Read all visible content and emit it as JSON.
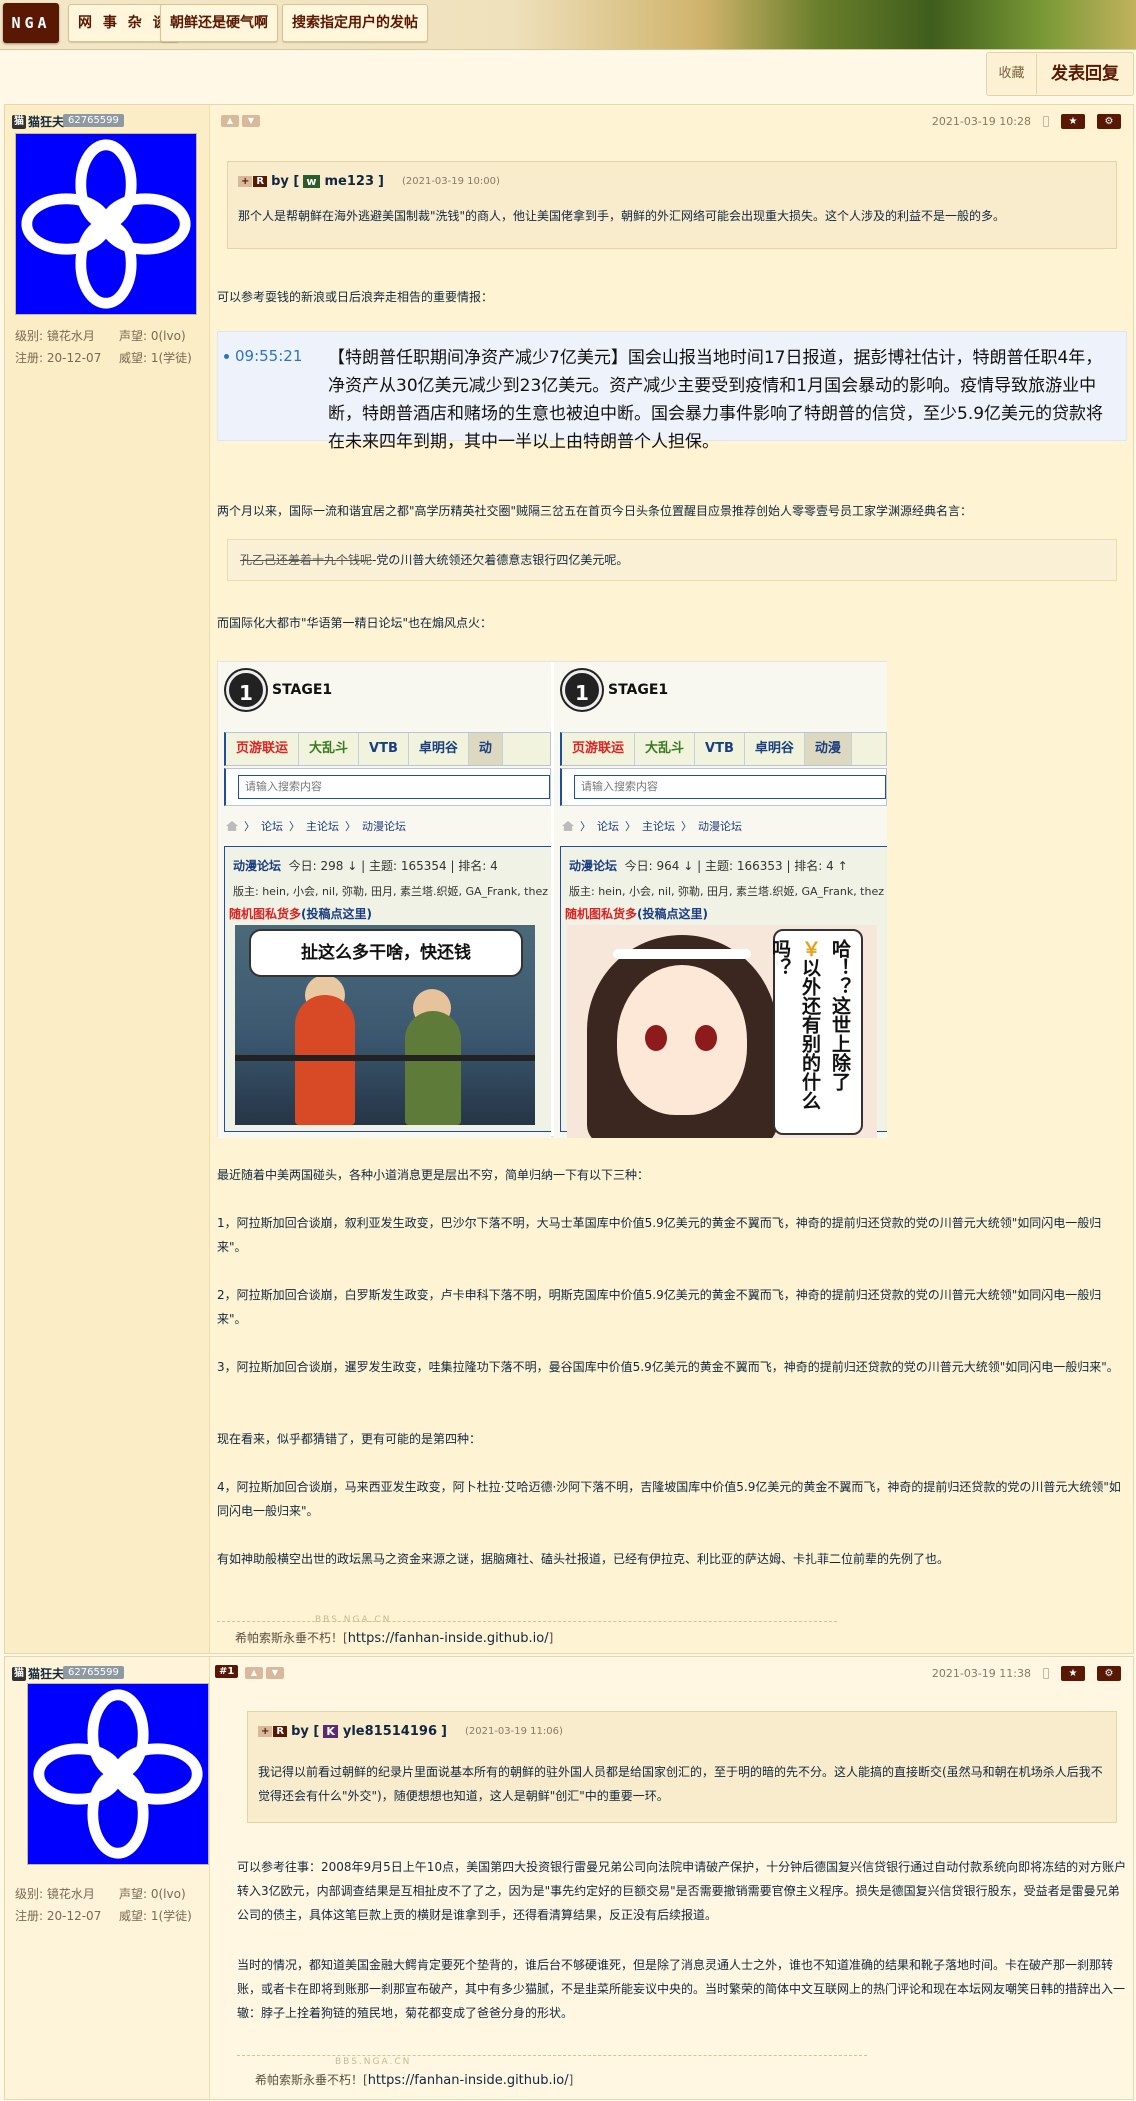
{
  "topbar": {
    "logo": "NGA",
    "crumbs": [
      "网 事 杂 谈",
      "朝鲜还是硬气啊",
      "搜索指定用户的发帖"
    ]
  },
  "actions": {
    "favorite": "收藏",
    "reply": "发表回复"
  },
  "posts": [
    {
      "author": "猫狂夫",
      "author_badge": "猫",
      "uid": "62765599",
      "level_label": "级别: 镜花水月",
      "rep_label": "声望: 0(lvo)",
      "reg_label": "注册: 20-12-07",
      "prestige_label": "威望: 1(学徒)",
      "date": "2021-03-19 10:28",
      "quote": {
        "user_badge": "w",
        "user": "me123",
        "by": "by [",
        "close": "]",
        "date": "(2021-03-19 10:00)",
        "text": "那个人是帮朝鲜在海外逃避美国制裁\"洗钱\"的商人，他让美国佬拿到手，朝鲜的外汇网络可能会出现重大损失。这个人涉及的利益不是一般的多。"
      },
      "p1": "可以参考耍钱的新浪或日后浪奔走相告的重要情报：",
      "news_time": "09:55:21",
      "news_text": "【特朗普任职期间净资产减少7亿美元】国会山报当地时间17日报道，据彭博社估计，特朗普任职4年，净资产从30亿美元减少到23亿美元。资产减少主要受到疫情和1月国会暴动的影响。疫情导致旅游业中断，特朗普酒店和赌场的生意也被迫中断。国会暴力事件影响了特朗普的信贷，至少5.9亿美元的贷款将在未来四年到期，其中一半以上由特朗普个人担保。",
      "p2": "两个月以来，国际一流和谐宜居之都\"高学历精英社交圈\"贼隔三岔五在首页今日头条位置醒目应景推荐创始人零零壹号员工家学渊源经典名言：",
      "strike_text": "孔乙己还差着十九个钱呢",
      "strike_after": "-党の川普大统领还欠着德意志银行四亿美元呢。",
      "p3": "而国际化大都市\"华语第一精日论坛\"也在煽风点火：",
      "meme": {
        "stage": "STAGE1",
        "disc": "1",
        "nav_left": [
          "页游联运",
          "大乱斗",
          "VTB",
          "卓明谷",
          "动"
        ],
        "nav_right": [
          "页游联运",
          "大乱斗",
          "VTB",
          "卓明谷",
          "动漫"
        ],
        "search_placeholder": "请输入搜索内容",
        "breadcrumb": [
          "论坛",
          "主论坛",
          "动漫论坛"
        ],
        "forum_name": "动漫论坛",
        "left_stats": "今日: 298 ↓ | 主题: 165354 | 排名: 4",
        "right_stats": "今日: 964 ↓ | 主题: 166353 | 排名: 4 ↑",
        "mods": "版主: hein, 小会, nil, 弥勒, 田月, 素兰塔.织姬, GA_Frank, thez",
        "banner_red": "随机图私货多",
        "banner_blue": "(投稿点这里)",
        "left_bubble": "扯这么多干啥，快还钱",
        "right_sign_1": "哈！？这世上除了",
        "right_sign_yen": "￥",
        "right_sign_2": "以外还有别的什么吗？"
      },
      "p4": "最近随着中美两国碰头，各种小道消息更是层出不穷，简单归纳一下有以下三种：",
      "p5": "1，阿拉斯加回合谈崩，叙利亚发生政变，巴沙尔下落不明，大马士革国库中价值5.9亿美元的黄金不翼而飞，神奇的提前归还贷款的党の川普元大统领\"如同闪电一般归来\"。",
      "p6": "2，阿拉斯加回合谈崩，白罗斯发生政变，卢卡申科下落不明，明斯克国库中价值5.9亿美元的黄金不翼而飞，神奇的提前归还贷款的党の川普元大统领\"如同闪电一般归来\"。",
      "p7": "3，阿拉斯加回合谈崩，暹罗发生政变，哇集拉隆功下落不明，曼谷国库中价值5.9亿美元的黄金不翼而飞，神奇的提前归还贷款的党の川普元大统领\"如同闪电一般归来\"。",
      "p8": "现在看来，似乎都猜错了，更有可能的是第四种：",
      "p9": "4，阿拉斯加回合谈崩，马来西亚发生政变，阿卜杜拉·艾哈迈德·沙阿下落不明，吉隆坡国库中价值5.9亿美元的黄金不翼而飞，神奇的提前归还贷款的党の川普元大统领\"如同闪电一般归来\"。",
      "p10": "有如神助般横空出世的政坛黑马之资金来源之谜，据脑瘫社、磕头社报道，已经有伊拉克、利比亚的萨达姆、卡扎菲二位前辈的先例了也。",
      "sig_tag": "BBS.NGA.CN",
      "sig_text": "希帕索斯永垂不朽！[",
      "sig_link": "https://fanhan-inside.github.io/",
      "sig_close": "]"
    },
    {
      "author": "猫狂夫",
      "author_badge": "猫",
      "uid": "62765599",
      "floor": "#1",
      "level_label": "级别: 镜花水月",
      "rep_label": "声望: 0(lvo)",
      "reg_label": "注册: 20-12-07",
      "prestige_label": "威望: 1(学徒)",
      "date": "2021-03-19 11:38",
      "quote": {
        "user_badge": "K",
        "user": "yle81514196",
        "by": "by [",
        "close": "]",
        "date": "(2021-03-19 11:06)",
        "text": "我记得以前看过朝鲜的纪录片里面说基本所有的朝鲜的驻外国人员都是给国家创汇的，至于明的暗的先不分。这人能搞的直接断交(虽然马和朝在机场杀人后我不觉得还会有什么\"外交\")，随便想想也知道，这人是朝鲜\"创汇\"中的重要一环。"
      },
      "p1": "可以参考往事：2008年9月5日上午10点，美国第四大投资银行雷曼兄弟公司向法院申请破产保护，十分钟后德国复兴信贷银行通过自动付款系统向即将冻结的对方账户转入3亿欧元，内部调查结果是互相扯皮不了了之，因为是\"事先约定好的巨额交易\"是否需要撤销需要官僚主义程序。损失是德国复兴信贷银行股东，受益者是雷曼兄弟公司的债主，具体这笔巨款上贡的横财是谁拿到手，还得看清算结果，反正没有后续报道。",
      "p2": "当时的情况，都知道美国金融大鳄肯定要死个垫背的，谁后台不够硬谁死，但是除了消息灵通人士之外，谁也不知道准确的结果和靴子落地时间。卡在破产那一刹那转账，或者卡在即将到账那一刹那宣布破产，其中有多少猫腻，不是韭菜所能妄议中央的。当时繁荣的简体中文互联网上的热门评论和现在本坛网友嘲笑日韩的措辞出入一辙：脖子上拴着狗链的殖民地，菊花都变成了爸爸分身的形状。",
      "sig_tag": "BBS.NGA.CN",
      "sig_text": "希帕索斯永垂不朽！[",
      "sig_link": "https://fanhan-inside.github.io/",
      "sig_close": "]"
    }
  ]
}
